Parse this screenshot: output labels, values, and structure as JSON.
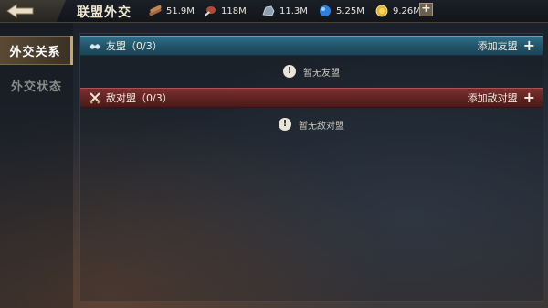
{
  "header": {
    "title": "联盟外交",
    "resources": [
      {
        "name": "wood",
        "icon": "wood-icon",
        "value": "51.9M"
      },
      {
        "name": "food",
        "icon": "meat-icon",
        "value": "118M"
      },
      {
        "name": "stone",
        "icon": "stone-icon",
        "value": "11.3M"
      },
      {
        "name": "gem",
        "icon": "gem-icon",
        "value": "5.25M"
      },
      {
        "name": "gold",
        "icon": "gold-coin-icon",
        "value": "9.26M"
      }
    ],
    "add_label": "+"
  },
  "sidebar": {
    "tabs": [
      {
        "label": "外交关系",
        "active": true
      },
      {
        "label": "外交状态",
        "active": false
      }
    ]
  },
  "sections": {
    "ally": {
      "title": "友盟（0/3）",
      "add_label": "添加友盟",
      "empty_text": "暂无友盟",
      "color": "#2a6580"
    },
    "enemy": {
      "title": "敌对盟（0/3）",
      "add_label": "添加敌对盟",
      "empty_text": "暂无敌对盟",
      "color": "#6e2828"
    }
  },
  "colors": {
    "accent_gold": "#c9a865"
  }
}
